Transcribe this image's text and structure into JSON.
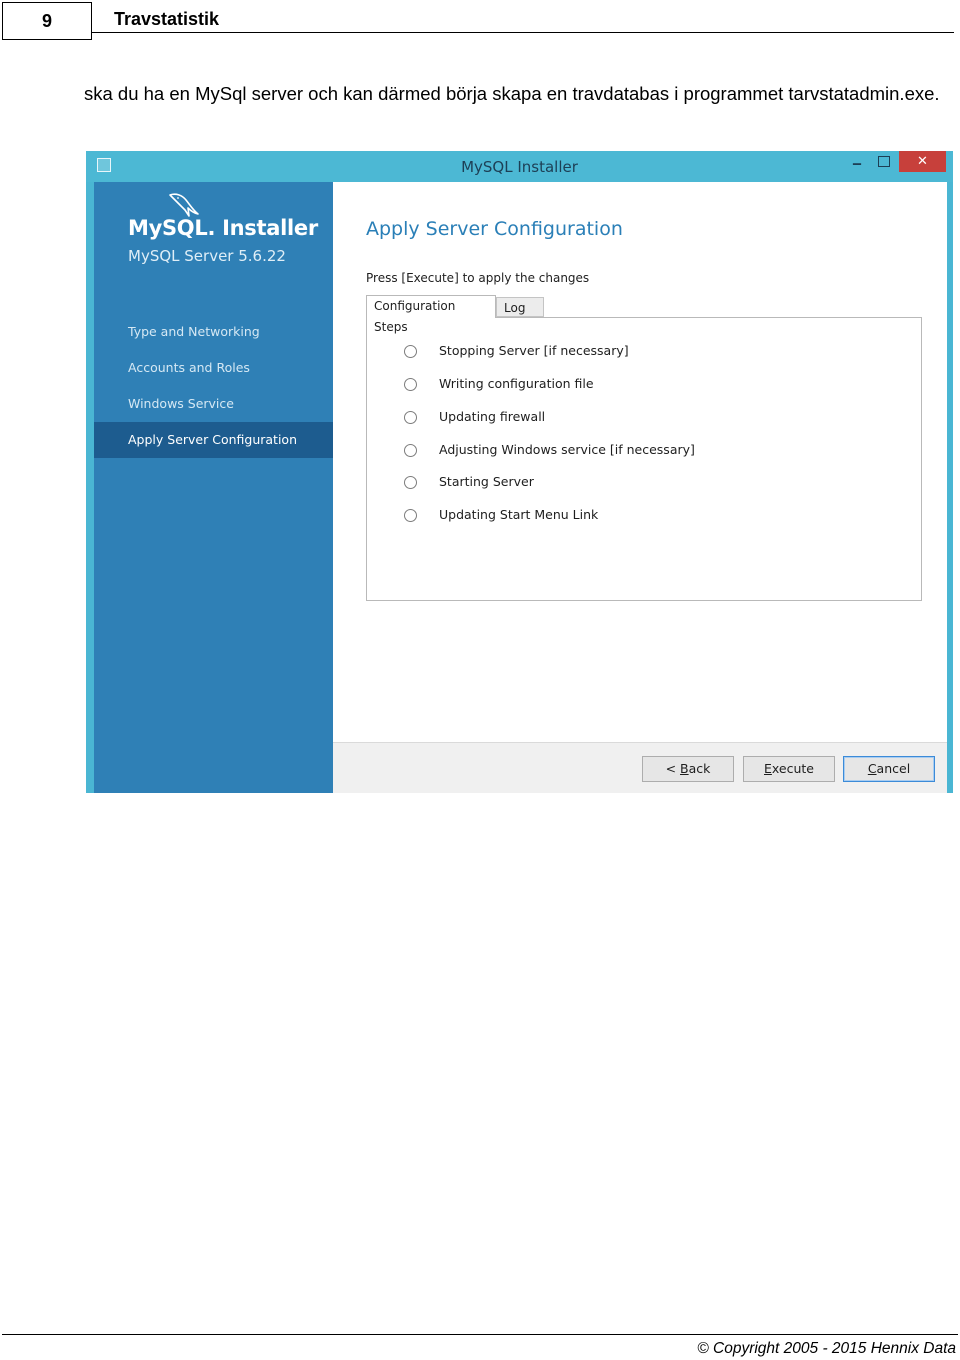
{
  "page": {
    "number": "9",
    "header_title": "Travstatistik",
    "intro_text": "ska du ha en MySql server och kan därmed börja skapa en travdatabas i programmet tarvstatadmin.exe.",
    "copyright": "© Copyright  2005 - 2015  Hennix Data"
  },
  "window": {
    "title": "MySQL Installer",
    "minimize_glyph": "‒",
    "close_glyph": "✕",
    "brand": {
      "title": "MySQL. Installer",
      "subtitle": "MySQL Server 5.6.22",
      "logo_icon": "dolphin-icon"
    },
    "nav": [
      {
        "label": "Type and Networking",
        "active": false
      },
      {
        "label": "Accounts and Roles",
        "active": false
      },
      {
        "label": "Windows Service",
        "active": false
      },
      {
        "label": "Apply Server Configuration",
        "active": true
      }
    ],
    "section_title": "Apply Server Configuration",
    "instruction": "Press [Execute] to apply the changes",
    "tabs": [
      {
        "label": "Configuration Steps",
        "active": true
      },
      {
        "label": "Log",
        "active": false
      }
    ],
    "steps": [
      "Stopping Server [if necessary]",
      "Writing configuration file",
      "Updating firewall",
      "Adjusting Windows service [if necessary]",
      "Starting Server",
      "Updating Start Menu Link"
    ],
    "buttons": {
      "back_prefix": "< ",
      "back_mnemonic": "B",
      "back_rest": "ack",
      "execute_prefix": "",
      "execute_mnemonic": "E",
      "execute_rest": "xecute",
      "cancel_mnemonic": "C",
      "cancel_rest": "ancel"
    },
    "colors": {
      "titlebar": "#4cb8d4",
      "sidebar": "#2f80b6",
      "sidebar_active": "#1d5c8f",
      "accent_title": "#2a7fb7",
      "close_button": "#c7403b"
    }
  }
}
